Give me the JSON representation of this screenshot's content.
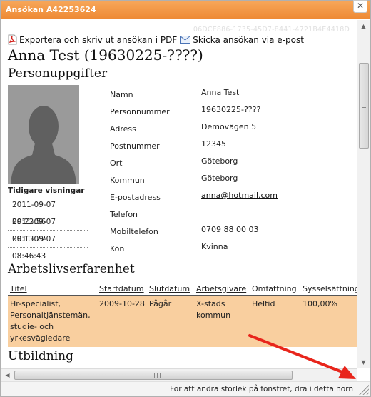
{
  "window": {
    "title": "Ansökan A42253624",
    "close_label": "✕",
    "guid": "06DCE886-1735-45D7-8441-4721B4E4418D"
  },
  "actions": {
    "export_pdf": "Exportera och skriv ut ansökan i PDF",
    "send_email": "Skicka ansökan via e-post"
  },
  "applicant": {
    "heading": "Anna Test (19630225-????)"
  },
  "personal": {
    "section_title": "Personuppgifter",
    "fields": [
      {
        "label": "Namn",
        "value": "Anna Test"
      },
      {
        "label": "Personnummer",
        "value": "19630225-????"
      },
      {
        "label": "Adress",
        "value": "Demovägen 5"
      },
      {
        "label": "Postnummer",
        "value": "12345"
      },
      {
        "label": "Ort",
        "value": "Göteborg"
      },
      {
        "label": "Kommun",
        "value": "Göteborg"
      },
      {
        "label": "E-postadress",
        "value": "anna@hotmail.com"
      },
      {
        "label": "Telefon",
        "value": ""
      },
      {
        "label": "Mobiltelefon",
        "value": "0709 88 00 03"
      },
      {
        "label": "Kön",
        "value": "Kvinna"
      }
    ]
  },
  "views": {
    "heading": "Tidigare visningar",
    "items": [
      "2011-09-07 09:22:56",
      "2011-09-07 09:13:22",
      "2011-09-07 08:46:43"
    ]
  },
  "experience": {
    "section_title": "Arbetslivserfarenhet",
    "columns": [
      "Titel",
      "Startdatum",
      "Slutdatum",
      "Arbetsgivare",
      "Omfattning",
      "Sysselsättning"
    ],
    "rows": [
      [
        "Hr-specialist, Personaltjänstemän, studie- och yrkesvägledare",
        "2009-10-28",
        "Pågår",
        "X-stads kommun",
        "Heltid",
        "100,00%"
      ]
    ]
  },
  "education": {
    "section_title": "Utbildning"
  },
  "status": {
    "hint": "För att ändra storlek på fönstret, dra i detta hörn"
  },
  "colors": {
    "titlebar": "#ee8a35",
    "row_highlight": "#f9cf9f",
    "annotation_arrow": "#e8251b"
  }
}
